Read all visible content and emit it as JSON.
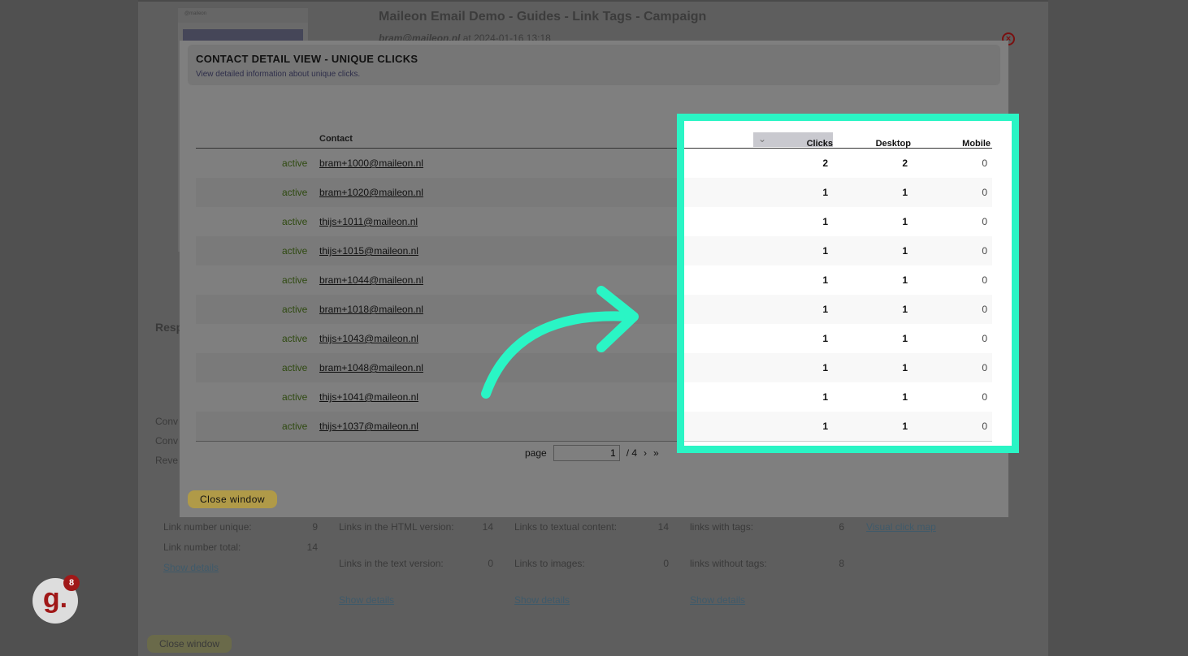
{
  "page": {
    "title": "Maileon Email Demo - Guides - Link Tags - Campaign",
    "author": "bram@maileon.nl",
    "at": "at",
    "date": "2024-01-16 13:18",
    "thumb_brand": "@maileon",
    "side_labels": [
      "Resp",
      "Conv",
      "Conv",
      "Reve"
    ],
    "stats": [
      {
        "rows": [
          [
            "Link number unique:",
            "9"
          ],
          [
            "Link number total:",
            "14"
          ]
        ],
        "link": "Show details"
      },
      {
        "rows": [
          [
            "Links in the HTML version:",
            "14"
          ],
          [
            "Links in the text version:",
            "0"
          ]
        ],
        "link": "Show details"
      },
      {
        "rows": [
          [
            "Links to textual content:",
            "14"
          ],
          [
            "Links to images:",
            "0"
          ]
        ],
        "link": "Show details"
      },
      {
        "rows": [
          [
            "links with tags:",
            "6"
          ],
          [
            "links without tags:",
            "8"
          ]
        ],
        "link": "Show details"
      }
    ],
    "visual_click_map": "Visual click map",
    "close_label": "Close window"
  },
  "modal": {
    "title": "CONTACT DETAIL VIEW - UNIQUE CLICKS",
    "subtitle": "View detailed information about unique clicks.",
    "columns": {
      "contact": "Contact",
      "clicks": "Clicks",
      "desktop": "Desktop",
      "mobile": "Mobile"
    },
    "rows": [
      {
        "status": "active",
        "email": "bram+1000@maileon.nl",
        "clicks": "2",
        "desktop": "2",
        "mobile": "0"
      },
      {
        "status": "active",
        "email": "bram+1020@maileon.nl",
        "clicks": "1",
        "desktop": "1",
        "mobile": "0"
      },
      {
        "status": "active",
        "email": "thijs+1011@maileon.nl",
        "clicks": "1",
        "desktop": "1",
        "mobile": "0"
      },
      {
        "status": "active",
        "email": "thijs+1015@maileon.nl",
        "clicks": "1",
        "desktop": "1",
        "mobile": "0"
      },
      {
        "status": "active",
        "email": "bram+1044@maileon.nl",
        "clicks": "1",
        "desktop": "1",
        "mobile": "0"
      },
      {
        "status": "active",
        "email": "bram+1018@maileon.nl",
        "clicks": "1",
        "desktop": "1",
        "mobile": "0"
      },
      {
        "status": "active",
        "email": "thijs+1043@maileon.nl",
        "clicks": "1",
        "desktop": "1",
        "mobile": "0"
      },
      {
        "status": "active",
        "email": "bram+1048@maileon.nl",
        "clicks": "1",
        "desktop": "1",
        "mobile": "0"
      },
      {
        "status": "active",
        "email": "thijs+1041@maileon.nl",
        "clicks": "1",
        "desktop": "1",
        "mobile": "0"
      },
      {
        "status": "active",
        "email": "thijs+1037@maileon.nl",
        "clicks": "1",
        "desktop": "1",
        "mobile": "0"
      }
    ],
    "pager": {
      "label": "page",
      "current": "1",
      "total": "/ 4",
      "next": "›",
      "last": "»"
    },
    "close_label": "Close window"
  },
  "badge": {
    "letter": "g.",
    "count": "8"
  },
  "colors": {
    "highlight": "#2af5c5",
    "active": "#5a8a20"
  }
}
